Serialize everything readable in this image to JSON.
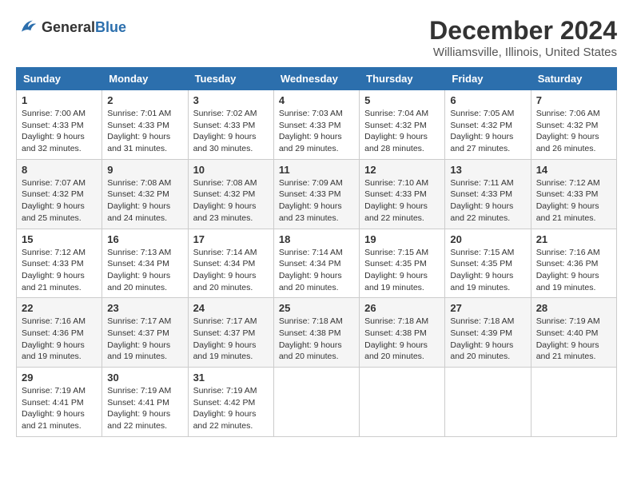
{
  "header": {
    "logo_general": "General",
    "logo_blue": "Blue",
    "month": "December 2024",
    "location": "Williamsville, Illinois, United States"
  },
  "days_of_week": [
    "Sunday",
    "Monday",
    "Tuesday",
    "Wednesday",
    "Thursday",
    "Friday",
    "Saturday"
  ],
  "weeks": [
    [
      {
        "day": "1",
        "sunrise": "7:00 AM",
        "sunset": "4:33 PM",
        "daylight": "9 hours and 32 minutes."
      },
      {
        "day": "2",
        "sunrise": "7:01 AM",
        "sunset": "4:33 PM",
        "daylight": "9 hours and 31 minutes."
      },
      {
        "day": "3",
        "sunrise": "7:02 AM",
        "sunset": "4:33 PM",
        "daylight": "9 hours and 30 minutes."
      },
      {
        "day": "4",
        "sunrise": "7:03 AM",
        "sunset": "4:33 PM",
        "daylight": "9 hours and 29 minutes."
      },
      {
        "day": "5",
        "sunrise": "7:04 AM",
        "sunset": "4:32 PM",
        "daylight": "9 hours and 28 minutes."
      },
      {
        "day": "6",
        "sunrise": "7:05 AM",
        "sunset": "4:32 PM",
        "daylight": "9 hours and 27 minutes."
      },
      {
        "day": "7",
        "sunrise": "7:06 AM",
        "sunset": "4:32 PM",
        "daylight": "9 hours and 26 minutes."
      }
    ],
    [
      {
        "day": "8",
        "sunrise": "7:07 AM",
        "sunset": "4:32 PM",
        "daylight": "9 hours and 25 minutes."
      },
      {
        "day": "9",
        "sunrise": "7:08 AM",
        "sunset": "4:32 PM",
        "daylight": "9 hours and 24 minutes."
      },
      {
        "day": "10",
        "sunrise": "7:08 AM",
        "sunset": "4:32 PM",
        "daylight": "9 hours and 23 minutes."
      },
      {
        "day": "11",
        "sunrise": "7:09 AM",
        "sunset": "4:33 PM",
        "daylight": "9 hours and 23 minutes."
      },
      {
        "day": "12",
        "sunrise": "7:10 AM",
        "sunset": "4:33 PM",
        "daylight": "9 hours and 22 minutes."
      },
      {
        "day": "13",
        "sunrise": "7:11 AM",
        "sunset": "4:33 PM",
        "daylight": "9 hours and 22 minutes."
      },
      {
        "day": "14",
        "sunrise": "7:12 AM",
        "sunset": "4:33 PM",
        "daylight": "9 hours and 21 minutes."
      }
    ],
    [
      {
        "day": "15",
        "sunrise": "7:12 AM",
        "sunset": "4:33 PM",
        "daylight": "9 hours and 21 minutes."
      },
      {
        "day": "16",
        "sunrise": "7:13 AM",
        "sunset": "4:34 PM",
        "daylight": "9 hours and 20 minutes."
      },
      {
        "day": "17",
        "sunrise": "7:14 AM",
        "sunset": "4:34 PM",
        "daylight": "9 hours and 20 minutes."
      },
      {
        "day": "18",
        "sunrise": "7:14 AM",
        "sunset": "4:34 PM",
        "daylight": "9 hours and 20 minutes."
      },
      {
        "day": "19",
        "sunrise": "7:15 AM",
        "sunset": "4:35 PM",
        "daylight": "9 hours and 19 minutes."
      },
      {
        "day": "20",
        "sunrise": "7:15 AM",
        "sunset": "4:35 PM",
        "daylight": "9 hours and 19 minutes."
      },
      {
        "day": "21",
        "sunrise": "7:16 AM",
        "sunset": "4:36 PM",
        "daylight": "9 hours and 19 minutes."
      }
    ],
    [
      {
        "day": "22",
        "sunrise": "7:16 AM",
        "sunset": "4:36 PM",
        "daylight": "9 hours and 19 minutes."
      },
      {
        "day": "23",
        "sunrise": "7:17 AM",
        "sunset": "4:37 PM",
        "daylight": "9 hours and 19 minutes."
      },
      {
        "day": "24",
        "sunrise": "7:17 AM",
        "sunset": "4:37 PM",
        "daylight": "9 hours and 19 minutes."
      },
      {
        "day": "25",
        "sunrise": "7:18 AM",
        "sunset": "4:38 PM",
        "daylight": "9 hours and 20 minutes."
      },
      {
        "day": "26",
        "sunrise": "7:18 AM",
        "sunset": "4:38 PM",
        "daylight": "9 hours and 20 minutes."
      },
      {
        "day": "27",
        "sunrise": "7:18 AM",
        "sunset": "4:39 PM",
        "daylight": "9 hours and 20 minutes."
      },
      {
        "day": "28",
        "sunrise": "7:19 AM",
        "sunset": "4:40 PM",
        "daylight": "9 hours and 21 minutes."
      }
    ],
    [
      {
        "day": "29",
        "sunrise": "7:19 AM",
        "sunset": "4:41 PM",
        "daylight": "9 hours and 21 minutes."
      },
      {
        "day": "30",
        "sunrise": "7:19 AM",
        "sunset": "4:41 PM",
        "daylight": "9 hours and 22 minutes."
      },
      {
        "day": "31",
        "sunrise": "7:19 AM",
        "sunset": "4:42 PM",
        "daylight": "9 hours and 22 minutes."
      },
      null,
      null,
      null,
      null
    ]
  ]
}
